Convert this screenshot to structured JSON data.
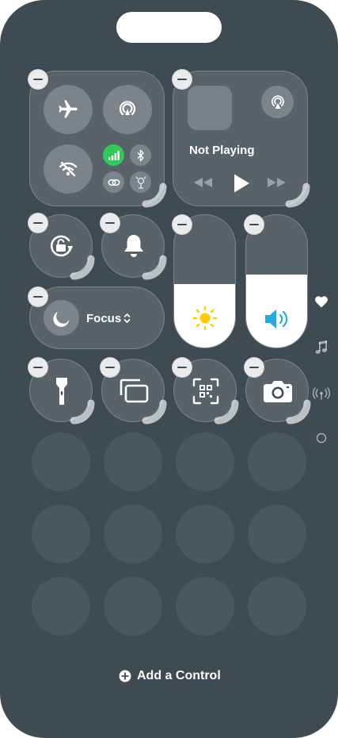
{
  "media": {
    "status": "Not Playing"
  },
  "focus": {
    "label": "Focus"
  },
  "sliders": {
    "brightness_level": 0.48,
    "volume_level": 0.55
  },
  "footer": {
    "add_control_label": "Add a Control"
  },
  "colors": {
    "background": "#3e4b53",
    "cellular_active": "#34c759",
    "brightness_icon": "#ffcc00",
    "volume_icon": "#2aa9e0"
  },
  "side_pages": [
    "heart-icon",
    "music-note-icon",
    "antenna-icon",
    "circle-page-icon"
  ]
}
